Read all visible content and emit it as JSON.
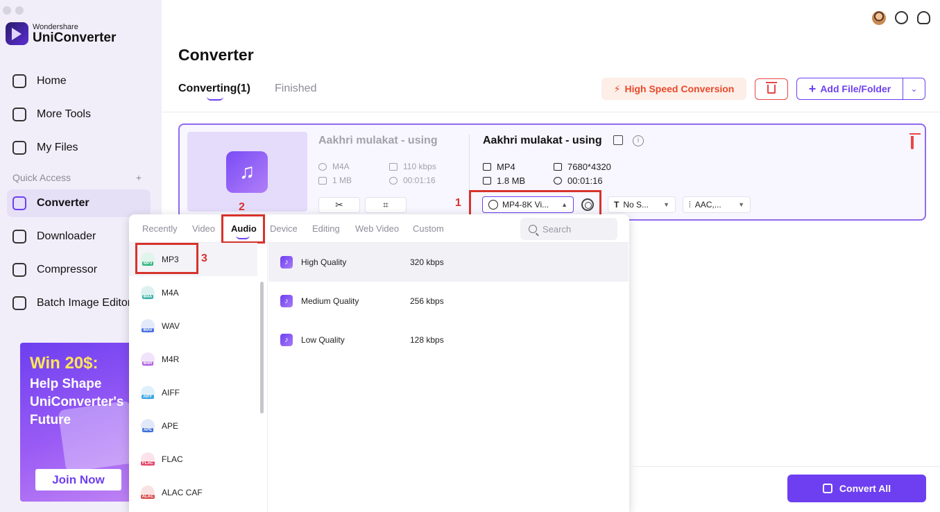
{
  "brand": {
    "small": "Wondershare",
    "name": "UniConverter"
  },
  "sidebar": {
    "items": [
      {
        "label": "Home",
        "icon": "home-icon"
      },
      {
        "label": "More Tools",
        "icon": "toolbox-icon"
      },
      {
        "label": "My Files",
        "icon": "files-icon"
      }
    ],
    "quick_access_label": "Quick Access",
    "quick_access_add": "+",
    "quick_items": [
      {
        "label": "Converter",
        "icon": "converter-icon",
        "active": true
      },
      {
        "label": "Downloader",
        "icon": "downloader-icon"
      },
      {
        "label": "Compressor",
        "icon": "compressor-icon"
      },
      {
        "label": "Batch Image Editor",
        "icon": "image-editor-icon"
      }
    ],
    "promo": {
      "headline": "Win 20$:",
      "line1": "Help Shape",
      "line2": "UniConverter's",
      "line3": "Future",
      "button": "Join Now"
    }
  },
  "header": {
    "title": "Converter",
    "tabs": [
      {
        "label": "Converting(1)",
        "active": true
      },
      {
        "label": "Finished"
      }
    ],
    "high_speed": "High Speed Conversion",
    "add_file": "Add File/Folder",
    "dropdown_glyph": "⌄",
    "plus_glyph": "+",
    "bolt_glyph": "⚡"
  },
  "file": {
    "source": {
      "title": "Aakhri mulakat - using",
      "format": "M4A",
      "bitrate": "110 kbps",
      "size": "1 MB",
      "duration": "00:01:16"
    },
    "target": {
      "title": "Aakhri mulakat - using",
      "format": "MP4",
      "resolution": "7680*4320",
      "size": "1.8 MB",
      "duration": "00:01:16",
      "output_format": "MP4-8K Vi...",
      "subtitle": "No S...",
      "audio": "AAC,..."
    },
    "cut_glyph": "✂",
    "crop_glyph": "⌗",
    "info_glyph": "i",
    "music_glyph": "♫"
  },
  "steps": {
    "one": "1",
    "two": "2",
    "three": "3"
  },
  "format_panel": {
    "tabs": [
      "Recently",
      "Video",
      "Audio",
      "Device",
      "Editing",
      "Web Video",
      "Custom"
    ],
    "active_tab": "Audio",
    "search_placeholder": "Search",
    "formats": [
      {
        "label": "MP3",
        "tag": "MP3",
        "color": "#2fb37c"
      },
      {
        "label": "M4A",
        "tag": "M4A",
        "color": "#37b2a8"
      },
      {
        "label": "WAV",
        "tag": "WAV",
        "color": "#4a74e0"
      },
      {
        "label": "M4R",
        "tag": "M4R",
        "color": "#b161e0"
      },
      {
        "label": "AIFF",
        "tag": "AIFF",
        "color": "#3aa6e4"
      },
      {
        "label": "APE",
        "tag": "APE",
        "color": "#3c6fd8"
      },
      {
        "label": "FLAC",
        "tag": "FLAC",
        "color": "#e2456a"
      },
      {
        "label": "ALAC CAF",
        "tag": "ALAC",
        "color": "#d84a4a"
      }
    ],
    "qualities": [
      {
        "name": "High Quality",
        "bitrate": "320 kbps"
      },
      {
        "name": "Medium Quality",
        "bitrate": "256 kbps"
      },
      {
        "name": "Low Quality",
        "bitrate": "128 kbps"
      }
    ],
    "quality_glyph": "♪"
  },
  "footer": {
    "convert_all": "Convert All"
  }
}
